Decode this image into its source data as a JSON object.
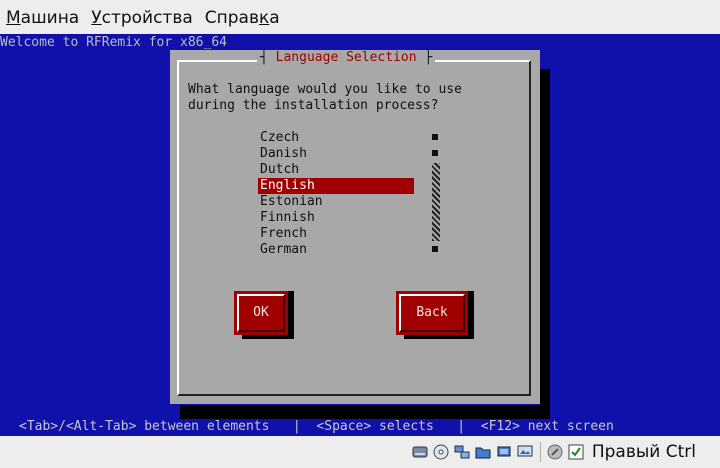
{
  "menubar": {
    "items": [
      {
        "label": "Машина",
        "accel": "М",
        "rest": "ашина"
      },
      {
        "label": "Устройства",
        "accel": "У",
        "rest": "стройства"
      },
      {
        "label": "Справка",
        "pre": "Справ",
        "accel": "к",
        "post": "а"
      }
    ]
  },
  "console": {
    "welcome": "Welcome to RFRemix for x86_64",
    "dialog": {
      "title": "Language Selection",
      "question_line1": "What language would you like to use",
      "question_line2": "during the installation process?",
      "languages": [
        "Czech",
        "Danish",
        "Dutch",
        "English",
        "Estonian",
        "Finnish",
        "French",
        "German"
      ],
      "selected": "English",
      "ok_label": "OK",
      "back_label": "Back"
    },
    "help_line": "<Tab>/<Alt-Tab> between elements   |  <Space> selects   |  <F12> next screen"
  },
  "statusbar": {
    "host_key": "Правый Ctrl",
    "icons": [
      "hard-disk-icon",
      "optical-disc-icon",
      "network-icon",
      "shared-folder-icon",
      "usb-icon",
      "display-icon",
      "mouse-integration-icon",
      "capture-arrow-icon"
    ]
  },
  "colors": {
    "console_bg": "#1010aa",
    "dialog_bg": "#a8a8a8",
    "accent_red": "#a00000"
  }
}
